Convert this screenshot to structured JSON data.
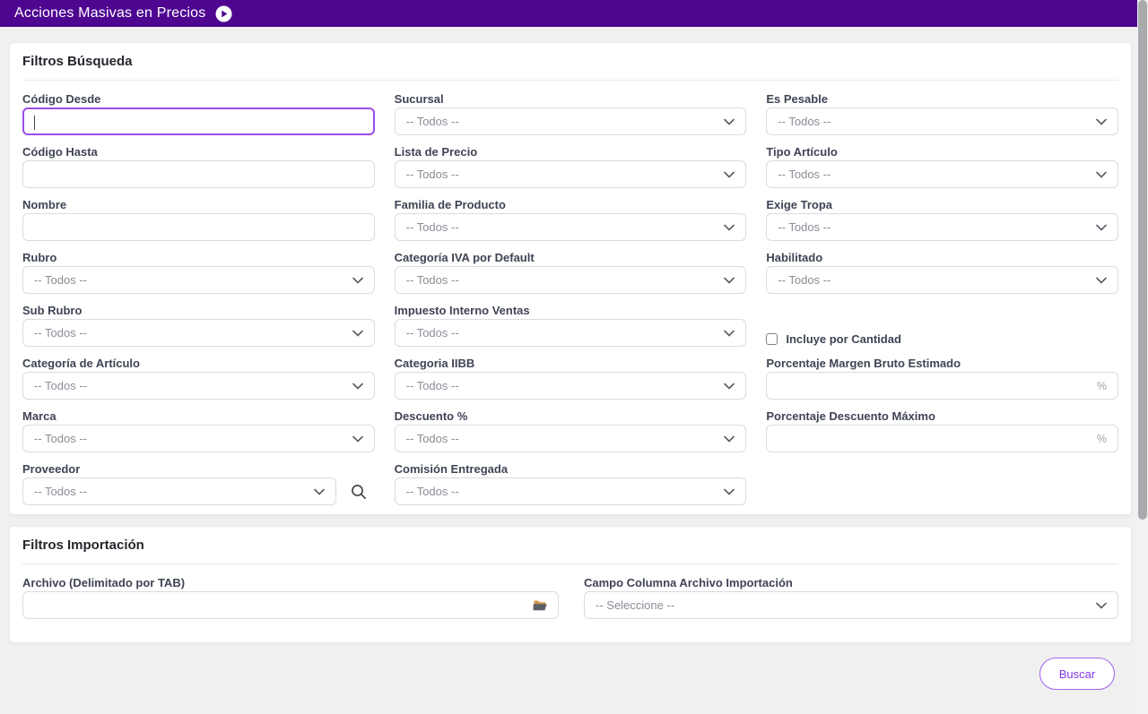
{
  "header": {
    "title": "Acciones Masivas en Precios"
  },
  "search_filters": {
    "title": "Filtros Búsqueda",
    "codigo_desde": {
      "label": "Código Desde",
      "value": ""
    },
    "codigo_hasta": {
      "label": "Código Hasta",
      "value": ""
    },
    "nombre": {
      "label": "Nombre",
      "value": ""
    },
    "rubro": {
      "label": "Rubro",
      "value": "-- Todos --"
    },
    "sub_rubro": {
      "label": "Sub Rubro",
      "value": "-- Todos --"
    },
    "categoria_articulo": {
      "label": "Categoría de Artículo",
      "value": "-- Todos --"
    },
    "marca": {
      "label": "Marca",
      "value": "-- Todos --"
    },
    "proveedor": {
      "label": "Proveedor",
      "value": "-- Todos --"
    },
    "sucursal": {
      "label": "Sucursal",
      "value": "-- Todos --"
    },
    "lista_precio": {
      "label": "Lista de Precio",
      "value": "-- Todos --"
    },
    "familia_producto": {
      "label": "Familia de Producto",
      "value": "-- Todos --"
    },
    "categoria_iva": {
      "label": "Categoría IVA por Default",
      "value": "-- Todos --"
    },
    "impuesto_interno": {
      "label": "Impuesto Interno Ventas",
      "value": "-- Todos --"
    },
    "categoria_iibb": {
      "label": "Categoria IIBB",
      "value": "-- Todos --"
    },
    "descuento": {
      "label": "Descuento %",
      "value": "-- Todos --"
    },
    "comision_entregada": {
      "label": "Comisión Entregada",
      "value": "-- Todos --"
    },
    "es_pesable": {
      "label": "Es Pesable",
      "value": "-- Todos --"
    },
    "tipo_articulo": {
      "label": "Tipo Artículo",
      "value": "-- Todos --"
    },
    "exige_tropa": {
      "label": "Exige Tropa",
      "value": "-- Todos --"
    },
    "habilitado": {
      "label": "Habilitado",
      "value": "-- Todos --"
    },
    "incluye_por_cantidad": {
      "label": "Incluye por Cantidad",
      "checked": false
    },
    "margen_bruto": {
      "label": "Porcentaje Margen Bruto Estimado",
      "value": "",
      "suffix": "%"
    },
    "descuento_maximo": {
      "label": "Porcentaje Descuento Máximo",
      "value": "",
      "suffix": "%"
    }
  },
  "import_filters": {
    "title": "Filtros Importación",
    "archivo": {
      "label": "Archivo (Delimitado por TAB)",
      "value": ""
    },
    "campo_columna": {
      "label": "Campo Columna Archivo Importación",
      "value": "-- Seleccione --"
    }
  },
  "actions": {
    "buscar_label": "Buscar"
  },
  "icons": {
    "header": "play-circle",
    "selects": "chevron-down",
    "proveedor": "search-magnifier",
    "archivo": "open-folder"
  },
  "colors": {
    "header_purple": "#4e0690",
    "focus_purple": "#9b4dea",
    "button_purple": "#8338e8",
    "page_background": "#f0f0f1"
  }
}
